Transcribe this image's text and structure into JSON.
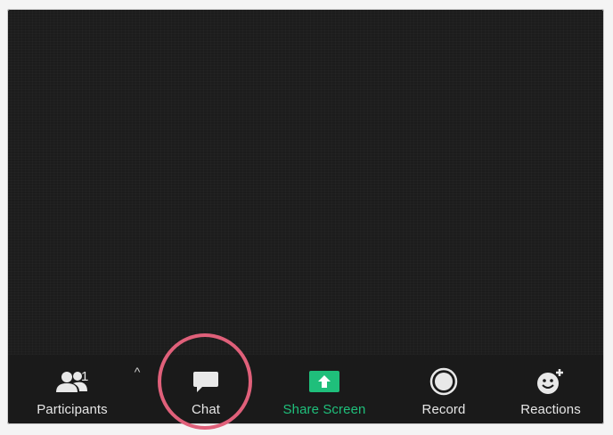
{
  "toolbar": {
    "participants": {
      "label": "Participants",
      "count": "1",
      "icon": "participants-icon"
    },
    "participants_menu": {
      "glyph": "^",
      "icon": "chevron-up-icon"
    },
    "chat": {
      "label": "Chat",
      "icon": "chat-icon"
    },
    "share_screen": {
      "label": "Share Screen",
      "icon": "share-screen-icon"
    },
    "record": {
      "label": "Record",
      "icon": "record-icon"
    },
    "reactions": {
      "label": "Reactions",
      "icon": "reactions-icon"
    }
  },
  "colors": {
    "toolbar_bg": "#1a1a1a",
    "share_green": "#1fbf7b",
    "highlight": "#e0607a",
    "label": "#e6e6e6"
  }
}
